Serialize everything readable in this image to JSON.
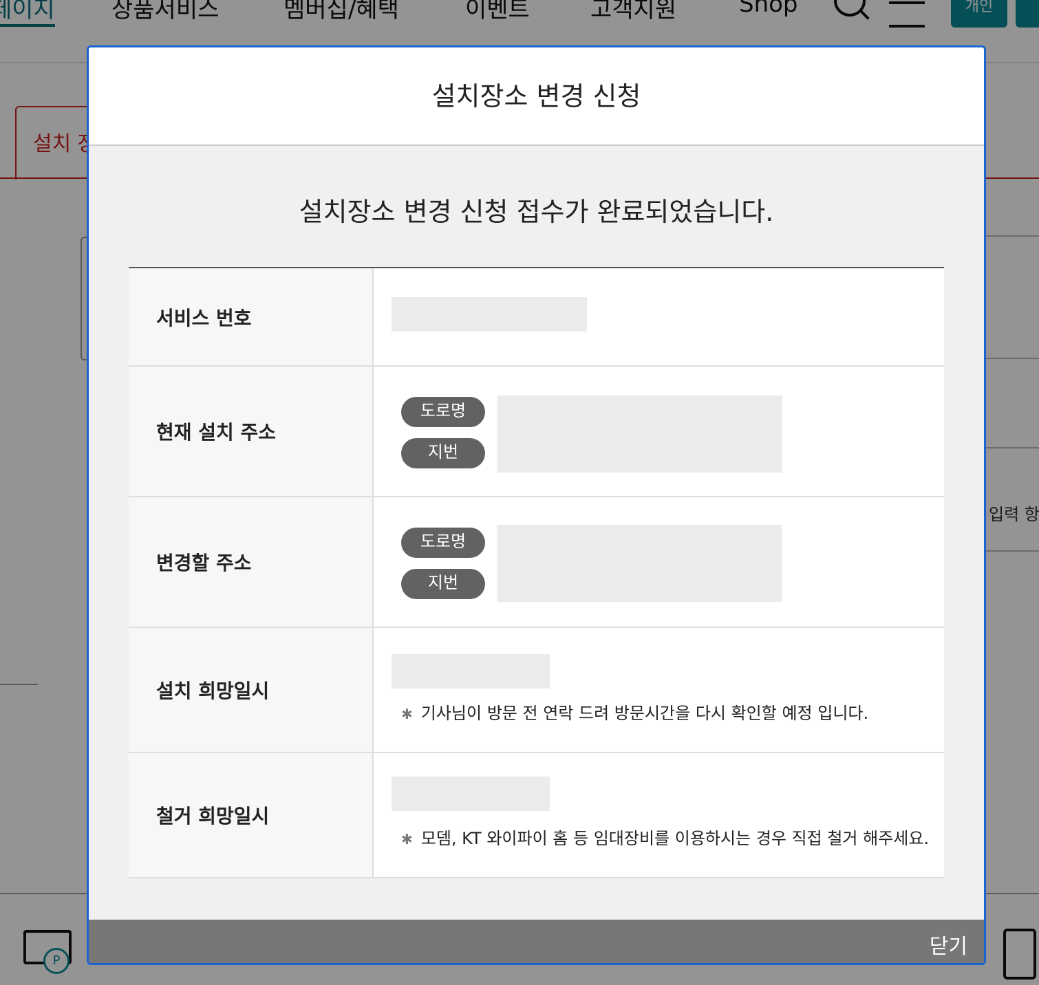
{
  "gnb": {
    "items": [
      "페이지",
      "상품서비스",
      "멤버십/혜택",
      "이벤트",
      "고객지원",
      "Shop"
    ],
    "button_label": "개인"
  },
  "background": {
    "tab_label": "설치 장",
    "side_text": "입력 항"
  },
  "modal": {
    "title": "설치장소 변경 신청",
    "message": "설치장소 변경 신청 접수가 완료되었습니다.",
    "rows": {
      "service_number": {
        "label": "서비스 번호"
      },
      "current_address": {
        "label": "현재 설치 주소",
        "road_label": "도로명",
        "lot_label": "지번"
      },
      "new_address": {
        "label": "변경할 주소",
        "road_label": "도로명",
        "lot_label": "지번"
      },
      "install_date": {
        "label": "설치 희망일시",
        "note": "기사님이 방문 전 연락 드려 방문시간을 다시 확인할 예정 입니다."
      },
      "remove_date": {
        "label": "철거 희망일시",
        "note": "모뎀, KT 와이파이 홈 등 임대장비를 이용하시는 경우 직접 철거 해주세요."
      }
    },
    "close_label": "닫기"
  }
}
